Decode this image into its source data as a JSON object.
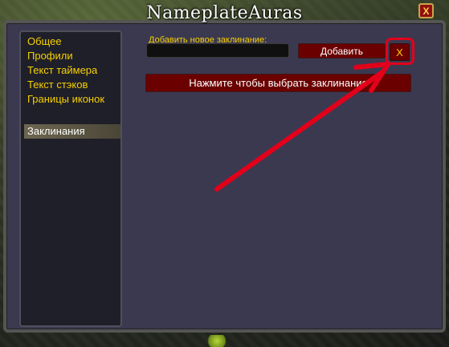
{
  "window": {
    "title": "NameplateAuras",
    "close_label": "X"
  },
  "sidebar": {
    "items": [
      {
        "label": "Общее"
      },
      {
        "label": "Профили"
      },
      {
        "label": "Текст таймера"
      },
      {
        "label": "Текст стэков"
      },
      {
        "label": "Границы иконок"
      }
    ],
    "selected": {
      "label": "Заклинания"
    }
  },
  "spells_panel": {
    "add_label": "Добавить новое заклинание:",
    "input_value": "",
    "add_button_label": "Добавить",
    "remove_button_label": "X",
    "select_button_label": "Нажмите чтобы выбрать заклинание"
  },
  "colors": {
    "accent_yellow": "#f7d000",
    "button_red": "#6b0000",
    "annotation_red": "#e3001a"
  }
}
